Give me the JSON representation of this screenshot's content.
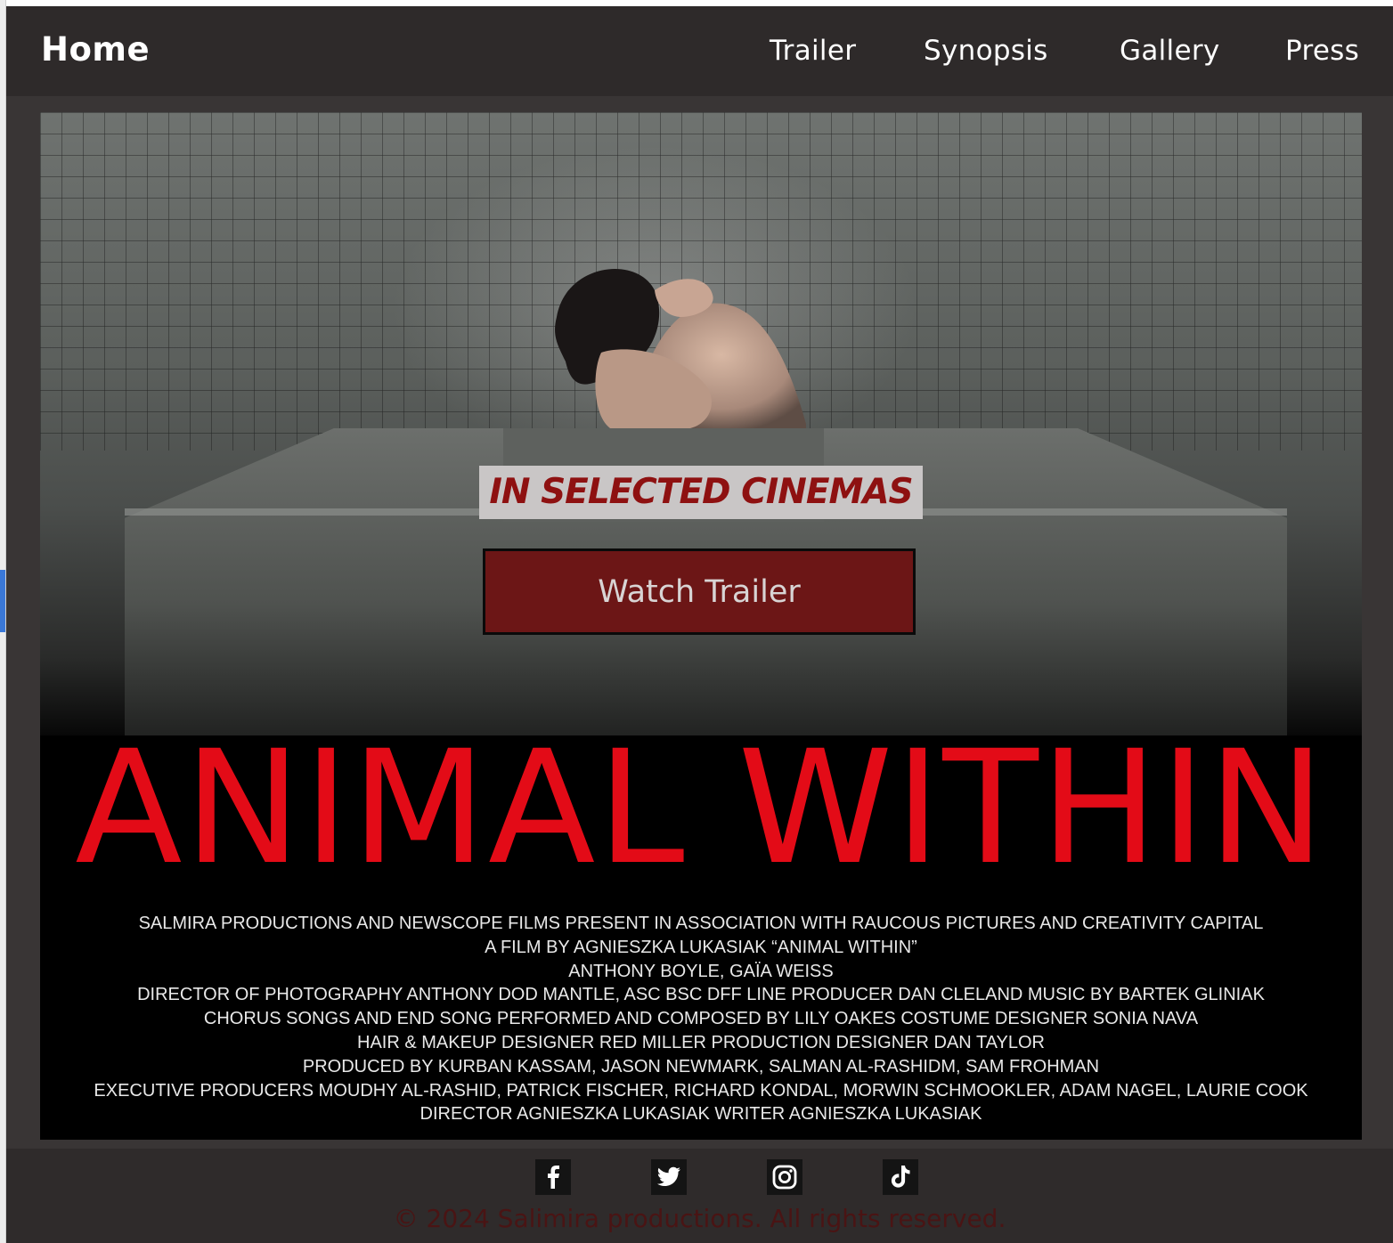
{
  "nav": {
    "home": "Home",
    "links": [
      "Trailer",
      "Synopsis",
      "Gallery",
      "Press"
    ]
  },
  "hero": {
    "tagline": "IN SELECTED CINEMAS",
    "watch_button": "Watch Trailer",
    "film_title": "ANIMAL WITHIN",
    "credits": [
      "SALMIRA PRODUCTIONS AND NEWSCOPE FILMS PRESENT IN ASSOCIATION WITH RAUCOUS PICTURES AND CREATIVITY CAPITAL",
      "A FILM BY AGNIESZKA LUKASIAK “ANIMAL WITHIN”",
      "ANTHONY BOYLE, GAÏA WEISS",
      "DIRECTOR OF PHOTOGRAPHY ANTHONY DOD MANTLE, ASC BSC DFF LINE PRODUCER DAN CLELAND MUSIC BY BARTEK GLINIAK",
      "CHORUS SONGS AND END SONG PERFORMED AND COMPOSED BY LILY OAKES COSTUME DESIGNER SONIA NAVA",
      "HAIR & MAKEUP DESIGNER RED MILLER PRODUCTION DESIGNER DAN TAYLOR",
      "PRODUCED BY KURBAN KASSAM, JASON NEWMARK, SALMAN AL-RASHIDM, SAM FROHMAN",
      "EXECUTIVE PRODUCERS MOUDHY AL-RASHID, PATRICK FISCHER, RICHARD KONDAL, MORWIN SCHMOOKLER, ADAM NAGEL, LAURIE COOK",
      "DIRECTOR AGNIESZKA LUKASIAK WRITER AGNIESZKA LUKASIAK"
    ]
  },
  "footer": {
    "social": [
      "facebook-icon",
      "twitter-icon",
      "instagram-icon",
      "tiktok-icon"
    ],
    "copyright": "© 2024 Salimira productions. All rights reserved."
  },
  "colors": {
    "page_bg": "#393535",
    "nav_bg": "#2e2a2a",
    "title_red": "#e30b17",
    "button_bg": "#6c1616",
    "tagline_red": "#8e1111",
    "copyright": "#4a1414"
  }
}
